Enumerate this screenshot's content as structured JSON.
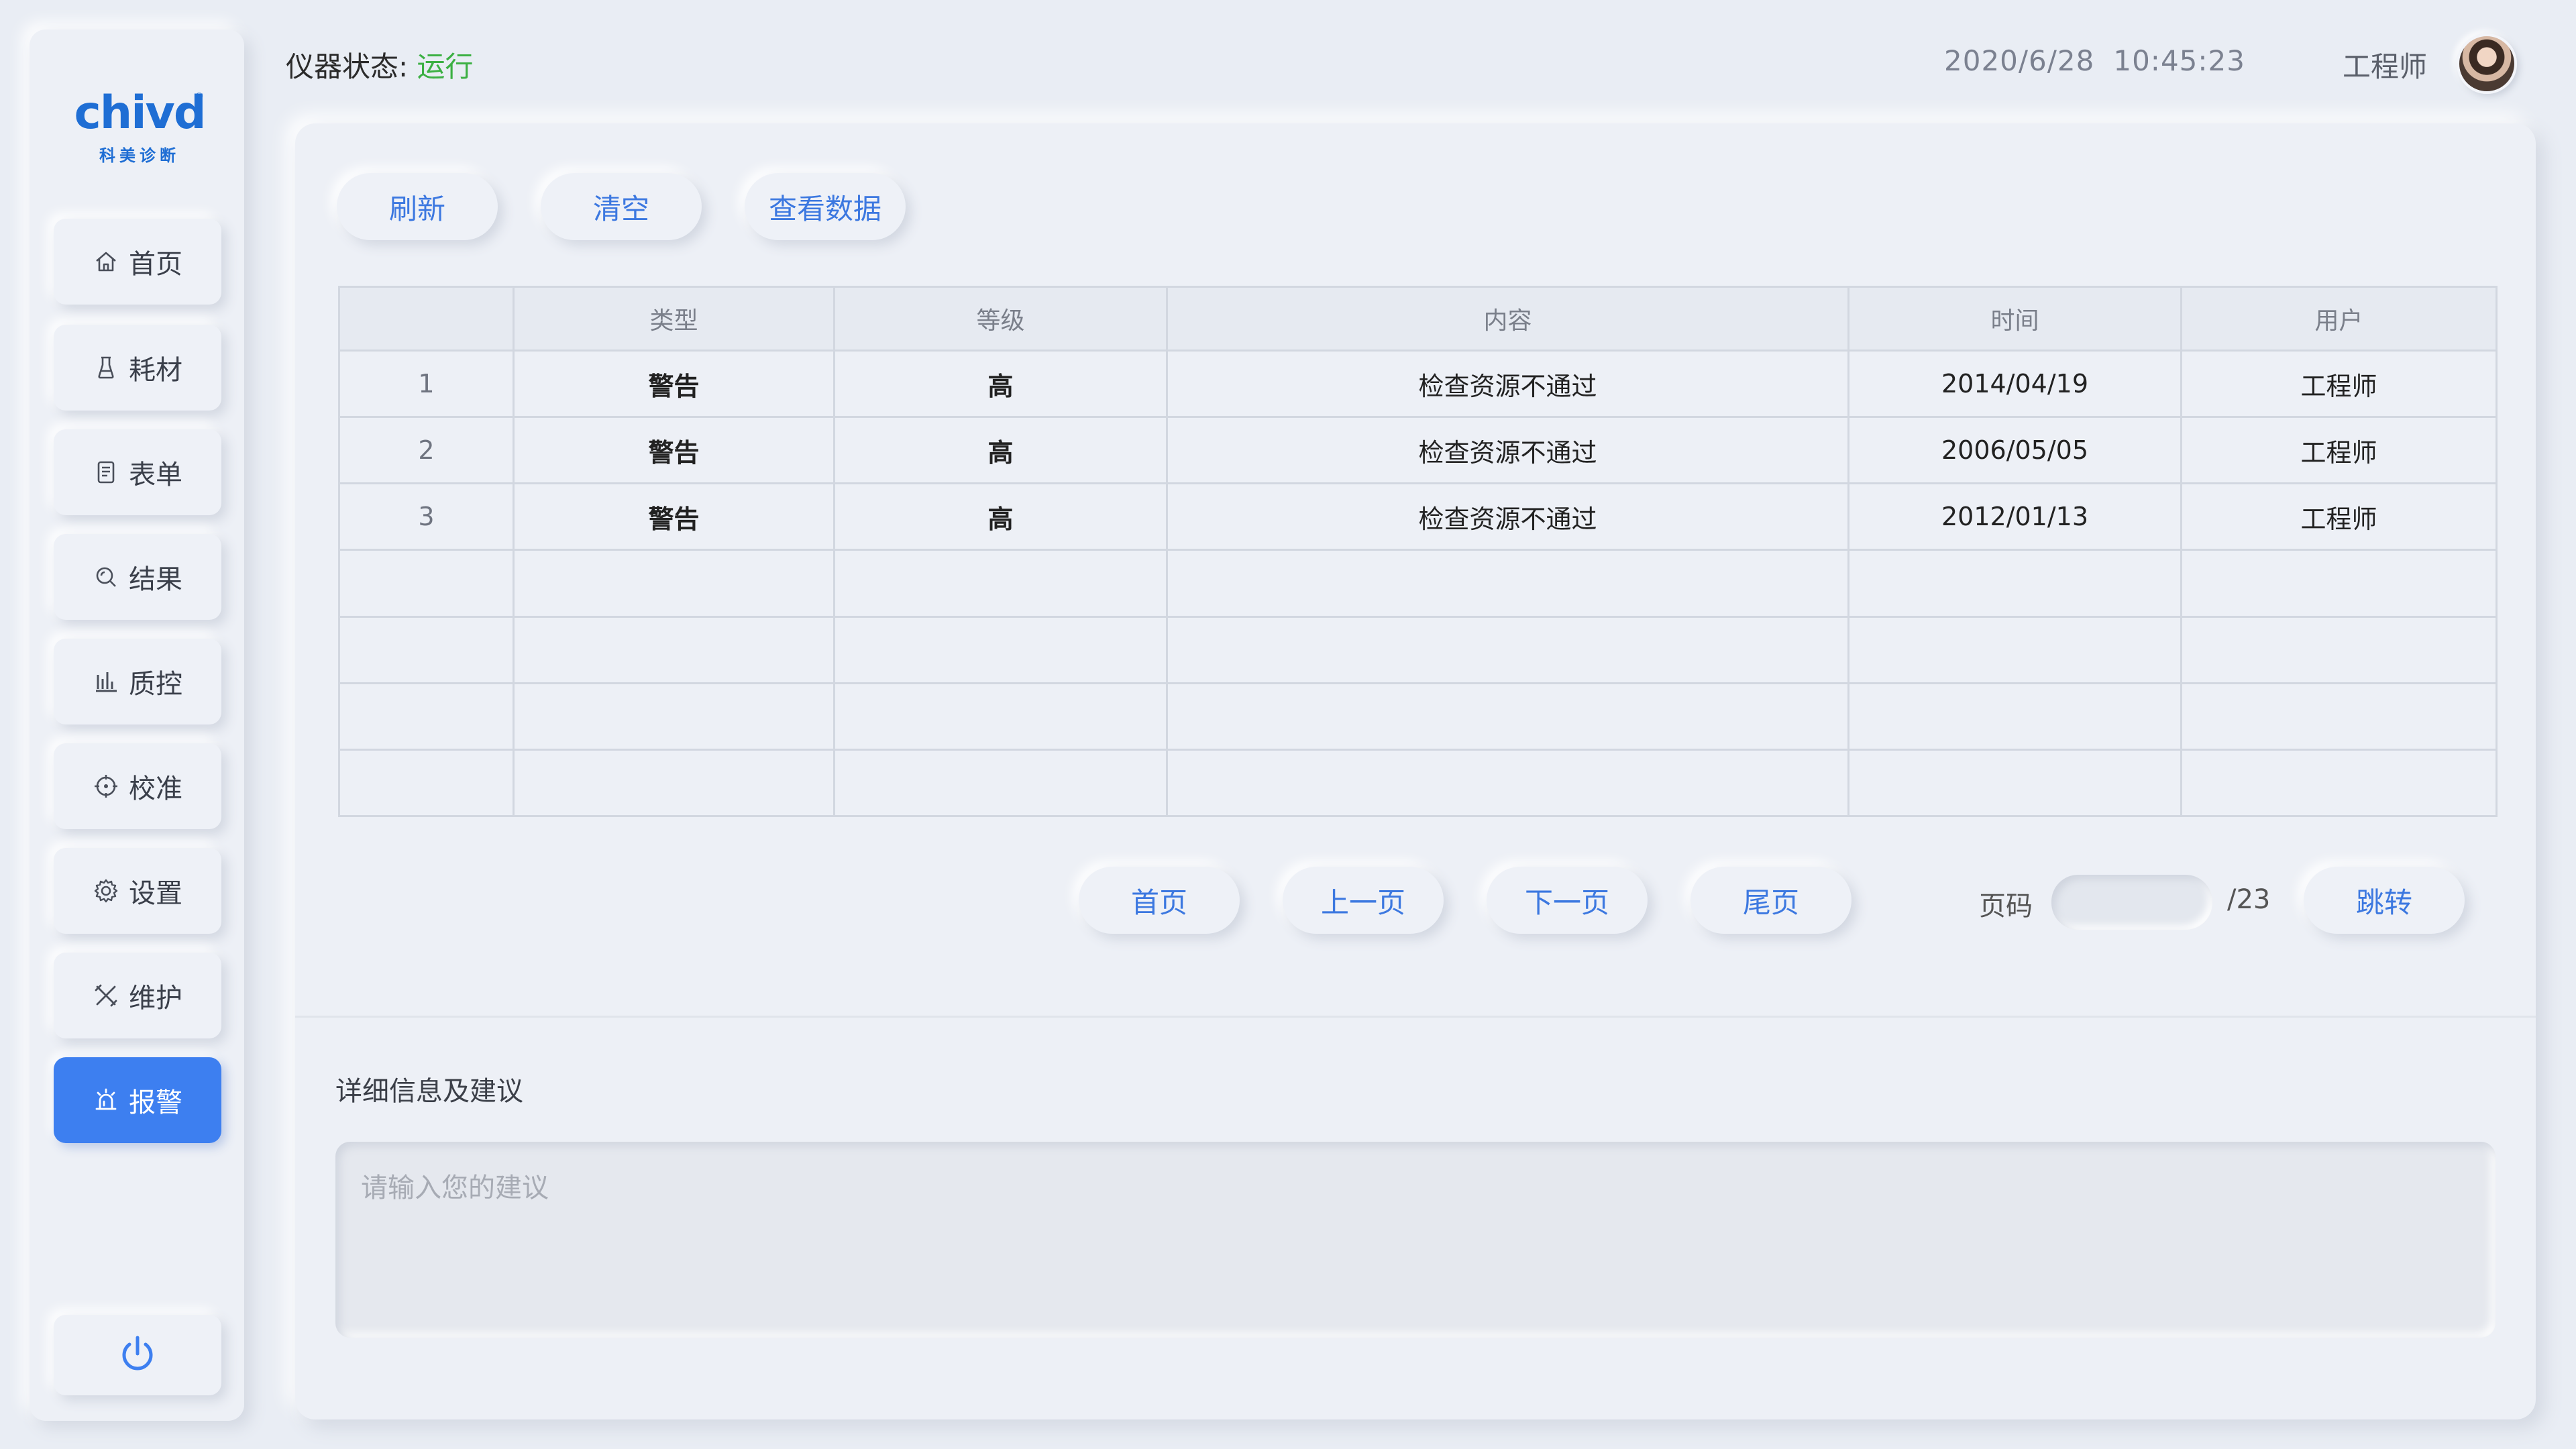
{
  "brand": {
    "logo_text": "chivd",
    "logo_sub": "科美诊断",
    "registered": "®"
  },
  "header": {
    "status_label": "仪器状态:",
    "status_value": "运行",
    "date": "2020/6/28",
    "time": "10:45:23",
    "user": "工程师"
  },
  "sidebar": {
    "items": [
      {
        "label": "首页",
        "icon": "home-icon"
      },
      {
        "label": "耗材",
        "icon": "flask-icon"
      },
      {
        "label": "表单",
        "icon": "document-icon"
      },
      {
        "label": "结果",
        "icon": "search-icon"
      },
      {
        "label": "质控",
        "icon": "bar-chart-icon"
      },
      {
        "label": "校准",
        "icon": "crosshair-icon"
      },
      {
        "label": "设置",
        "icon": "gear-icon"
      },
      {
        "label": "维护",
        "icon": "tools-icon"
      },
      {
        "label": "报警",
        "icon": "alarm-icon",
        "active": true
      }
    ],
    "power_icon": "power-icon"
  },
  "toolbar": {
    "refresh": "刷新",
    "clear": "清空",
    "view_data": "查看数据"
  },
  "table": {
    "columns": [
      "",
      "类型",
      "等级",
      "内容",
      "时间",
      "用户"
    ],
    "rows": [
      [
        "1",
        "警告",
        "高",
        "检查资源不通过",
        "2014/04/19",
        "工程师"
      ],
      [
        "2",
        "警告",
        "高",
        "检查资源不通过",
        "2006/05/05",
        "工程师"
      ],
      [
        "3",
        "警告",
        "高",
        "检查资源不通过",
        "2012/01/13",
        "工程师"
      ],
      [
        "",
        "",
        "",
        "",
        "",
        ""
      ],
      [
        "",
        "",
        "",
        "",
        "",
        ""
      ],
      [
        "",
        "",
        "",
        "",
        "",
        ""
      ],
      [
        "",
        "",
        "",
        "",
        "",
        ""
      ]
    ]
  },
  "pagination": {
    "first": "首页",
    "prev": "上一页",
    "next": "下一页",
    "last": "尾页",
    "page_label": "页码",
    "page_value": "",
    "total": "/23",
    "jump": "跳转"
  },
  "detail": {
    "title": "详细信息及建议",
    "placeholder": "请输入您的建议"
  },
  "colors": {
    "accent": "#3d7ff0",
    "running": "#3cb043",
    "link": "#3c78e0"
  }
}
